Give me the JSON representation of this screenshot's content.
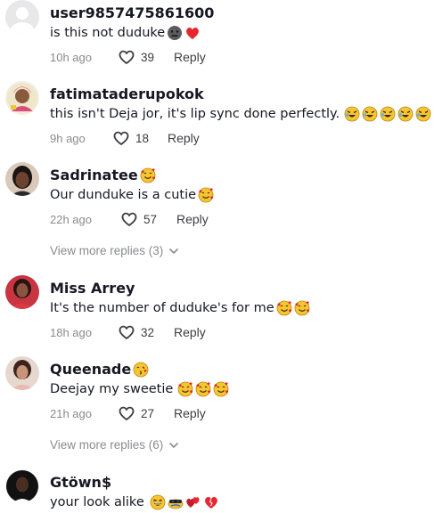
{
  "comments": [
    {
      "username": "user9857475861600",
      "text": "is this not duduke",
      "emojis": [
        "neutral-face",
        "red-heart"
      ],
      "time": "10h ago",
      "likes": "39",
      "reply": "Reply",
      "avatar": "default-avatar"
    },
    {
      "username": "fatimataderupokok",
      "text": "this isn't Deja jor, it's lip sync done perfectly.",
      "emojis": [
        "rolling-laughing",
        "rolling-laughing",
        "rolling-laughing",
        "rolling-laughing",
        "rolling-laughing"
      ],
      "time": "9h ago",
      "likes": "18",
      "reply": "Reply",
      "avatar": "photo-avatar"
    },
    {
      "username": "Sadrinatee",
      "username_emoji": "smiling-hearts",
      "text": "Our dunduke is a cutie",
      "emojis": [
        "smiling-hearts"
      ],
      "time": "22h ago",
      "likes": "57",
      "reply": "Reply",
      "avatar": "photo-avatar",
      "more_replies": "View more replies (3)"
    },
    {
      "username": "Miss Arrey",
      "text": "It's the number of duduke's for me",
      "emojis": [
        "smiling-hearts",
        "smiling-hearts"
      ],
      "time": "18h ago",
      "likes": "32",
      "reply": "Reply",
      "avatar": "photo-avatar"
    },
    {
      "username": "Queenade",
      "username_emoji": "kissing-face",
      "text": "Deejay my sweetie",
      "emojis": [
        "smiling-hearts",
        "smiling-hearts",
        "smiling-hearts"
      ],
      "time": "21h ago",
      "likes": "27",
      "reply": "Reply",
      "avatar": "photo-avatar",
      "more_replies": "View more replies (6)"
    },
    {
      "username": "Gtöwn$",
      "text": "your look alike",
      "emojis": [
        "grinning-squint",
        "disguise-face",
        "red-hearts",
        "broken-heart"
      ],
      "avatar": "photo-avatar"
    }
  ],
  "colors": {
    "text": "#161823",
    "muted": "#8a8b91",
    "emoji_yellow": "#f7c531",
    "heart_red": "#e8262f"
  }
}
